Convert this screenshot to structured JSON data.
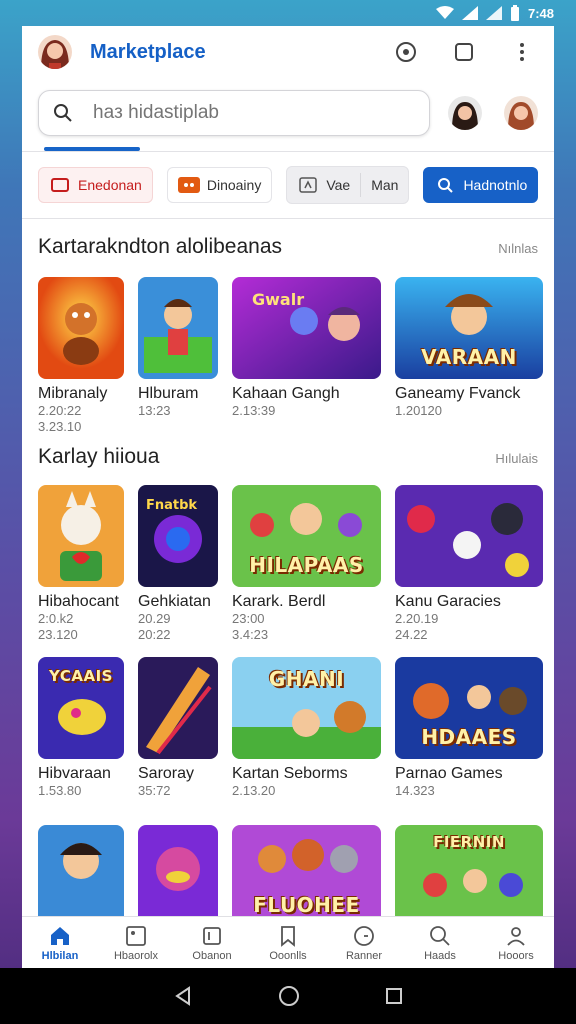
{
  "status": {
    "time": "7:48"
  },
  "app": {
    "title": "Marketplace"
  },
  "search": {
    "placeholder": "haз hidastiplab"
  },
  "chips": [
    {
      "label": "Enedonan",
      "icon": "screen-icon",
      "color": "#c51d1d"
    },
    {
      "label": "Dinoainy",
      "icon": "game-icon",
      "color": "#e25a12"
    },
    {
      "label": "Vae",
      "icon": "screen-icon"
    },
    {
      "label": "Man",
      "icon": ""
    },
    {
      "label": "Hadnotnlo",
      "icon": "search-icon",
      "color": "#1761c7"
    }
  ],
  "sections": [
    {
      "title": "Kartarakndton alolibeanas",
      "more": "Nılnlas",
      "games": [
        {
          "name": "Mibranaly",
          "meta1": "2.20:22",
          "meta2": "3.23.10",
          "label": ""
        },
        {
          "name": "Hlburam",
          "meta1": "13:23",
          "meta2": "",
          "label": ""
        },
        {
          "name": "Kahaan Gangh",
          "meta1": "2.13:39",
          "meta2": "",
          "label": ""
        },
        {
          "name": "Ganeamy Fvanck",
          "meta1": "1.20120",
          "meta2": "",
          "label": "VARAAN"
        }
      ]
    },
    {
      "title": "Karlay hiioua",
      "more": "Hılulais",
      "games": [
        {
          "name": "Hibahocant",
          "meta1": "2:0.k2",
          "meta2": "23.120",
          "label": ""
        },
        {
          "name": "Gehkiatan",
          "meta1": "20.29",
          "meta2": "20:22",
          "label": ""
        },
        {
          "name": "Karark. Berdl",
          "meta1": "23:00",
          "meta2": "3.4:23",
          "label": "HILAPAAS"
        },
        {
          "name": "Kanu Garacies",
          "meta1": "2.20.19",
          "meta2": "24.22",
          "label": ""
        }
      ]
    },
    {
      "games": [
        {
          "name": "Hibvaraan",
          "meta1": "1.53.80",
          "label": "YCAAIS"
        },
        {
          "name": "Saroray",
          "meta1": "35:72",
          "label": ""
        },
        {
          "name": "Kartan Seborms",
          "meta1": "2.13.20",
          "label": "GHANI"
        },
        {
          "name": "Parnao Games",
          "meta1": "14.323",
          "label": "HDAAES"
        }
      ]
    },
    {
      "games": [
        {
          "label": ""
        },
        {
          "label": ""
        },
        {
          "label": "FLUOHEE"
        },
        {
          "label": "FIERNIN"
        }
      ]
    }
  ],
  "nav": [
    {
      "label": "Hlbilan",
      "icon": "home-icon",
      "active": true
    },
    {
      "label": "Hbaorolx",
      "icon": "media-icon"
    },
    {
      "label": "Obanon",
      "icon": "library-icon"
    },
    {
      "label": "Ooonlls",
      "icon": "bookmark-icon"
    },
    {
      "label": "Ranner",
      "icon": "clock-icon"
    },
    {
      "label": "Haads",
      "icon": "search-icon"
    },
    {
      "label": "Hooors",
      "icon": "person-icon"
    }
  ],
  "colors": {
    "accent": "#1761c7",
    "title": "#1560c6"
  }
}
